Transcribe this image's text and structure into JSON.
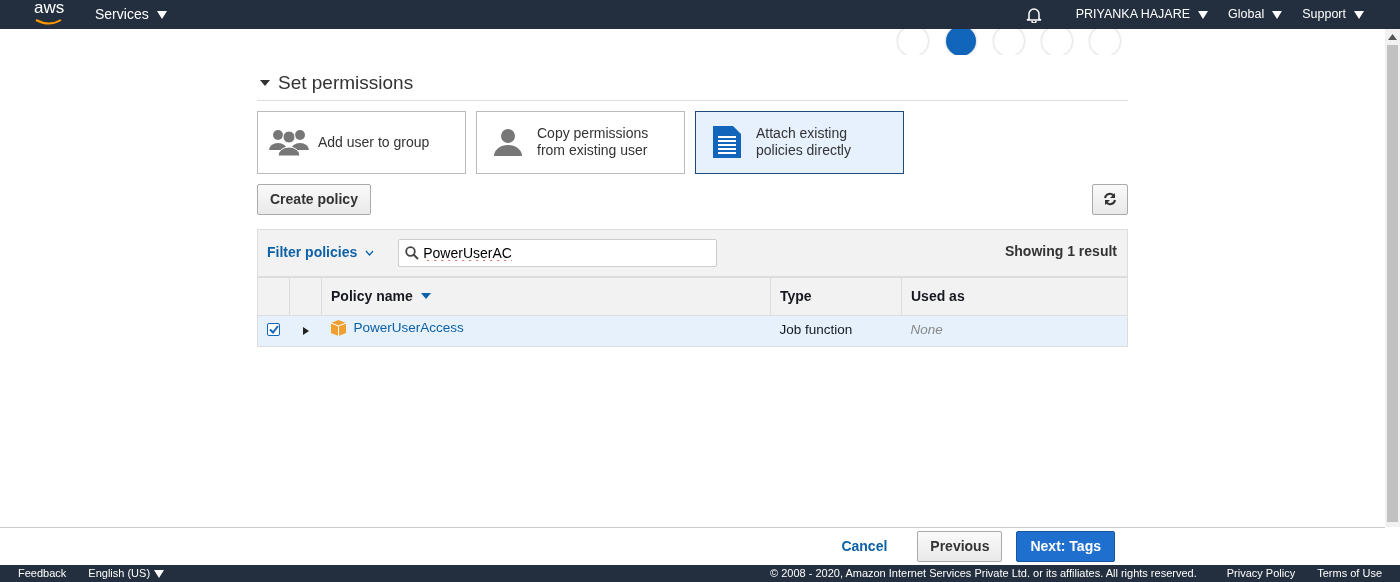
{
  "navbar": {
    "logo": "aws",
    "menu": "Services",
    "user": "PRIYANKA HAJARE",
    "region": "Global",
    "support": "Support"
  },
  "steps": [
    {
      "selected": false
    },
    {
      "selected": true
    },
    {
      "selected": false
    },
    {
      "selected": false
    },
    {
      "selected": false
    }
  ],
  "section": {
    "title": "Set permissions",
    "expanded": true
  },
  "options": [
    {
      "label": "Add user to group",
      "kind": "group",
      "selected": false
    },
    {
      "label": "Copy permissions from existing user",
      "kind": "user",
      "selected": false
    },
    {
      "label": "Attach existing policies directly",
      "kind": "document",
      "selected": true
    }
  ],
  "create_button": "Create policy",
  "filter": {
    "label": "Filter policies",
    "search_value": "PowerUserAC",
    "result_count": "Showing 1 result"
  },
  "table": {
    "columns": [
      {
        "label": "Policy name",
        "sorted": true
      },
      {
        "label": "Type",
        "sorted": false
      },
      {
        "label": "Used as",
        "sorted": false
      }
    ],
    "rows": [
      {
        "checked": true,
        "expanded": false,
        "name": "PowerUserAccess",
        "type": "Job function",
        "used_as": "None"
      }
    ]
  },
  "actions": {
    "cancel": "Cancel",
    "previous": "Previous",
    "next": "Next: Tags"
  },
  "footer": {
    "feedback": "Feedback",
    "language": "English (US)",
    "copyright": "© 2008 - 2020, Amazon Internet Services Private Ltd. or its affiliates. All rights reserved.",
    "links": [
      "Privacy Policy",
      "Terms of Use"
    ]
  }
}
